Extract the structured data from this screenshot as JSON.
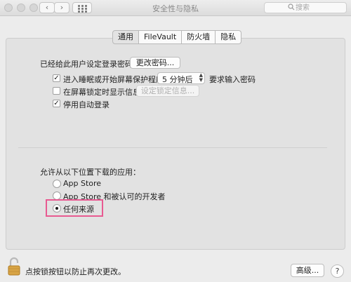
{
  "window": {
    "title": "安全性与隐私",
    "nav_back": "‹",
    "nav_forward": "›",
    "search_placeholder": "搜索",
    "search_icon": "magnifier-icon"
  },
  "tabs": [
    {
      "label": "通用",
      "active": true
    },
    {
      "label": "FileVault",
      "active": false
    },
    {
      "label": "防火墙",
      "active": false
    },
    {
      "label": "隐私",
      "active": false
    }
  ],
  "general": {
    "password_set_label": "已经给此用户设定登录密码",
    "change_password_button": "更改密码...",
    "require_password": {
      "checked": true,
      "label": "进入睡眠或开始屏幕保护程序",
      "delay_value": "5 分钟后",
      "suffix": "要求输入密码"
    },
    "show_message": {
      "checked": false,
      "label": "在屏幕锁定时显示信息",
      "button": "设定锁定信息...",
      "button_enabled": false
    },
    "disable_auto_login": {
      "checked": true,
      "label": "停用自动登录"
    }
  },
  "downloads": {
    "heading": "允许从以下位置下载的应用：",
    "options": [
      {
        "label": "App Store",
        "selected": false
      },
      {
        "label": "App Store 和被认可的开发者",
        "selected": false
      },
      {
        "label": "任何来源",
        "selected": true
      }
    ],
    "highlight_color": "#e85a91"
  },
  "footer": {
    "lock_text": "点按锁按钮以防止再次更改。",
    "advanced_button": "高级...",
    "help_button": "?",
    "lock_icon": "lock-open-icon"
  }
}
